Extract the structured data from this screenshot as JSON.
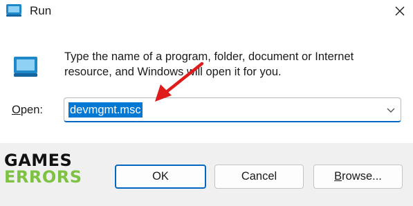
{
  "window": {
    "title": "Run",
    "icon": "run-icon",
    "close_icon": "close-icon"
  },
  "body": {
    "description_line1": "Type the name of a program, folder, document or Internet",
    "description_line2": "resource, and Windows will open it for you.",
    "open_label_prefix": "O",
    "open_label_rest": "pen:",
    "open_value": "devmgmt.msc",
    "dropdown_icon": "chevron-down-icon"
  },
  "buttons": {
    "ok": "OK",
    "cancel": "Cancel",
    "browse_prefix": "B",
    "browse_rest": "rowse..."
  },
  "logo": {
    "line1": "GAMES",
    "line2": "ERRORS"
  },
  "colors": {
    "accent": "#0067c0",
    "selection": "#0078d4",
    "arrow": "#e01b1b",
    "logo_green": "#7dc242"
  }
}
